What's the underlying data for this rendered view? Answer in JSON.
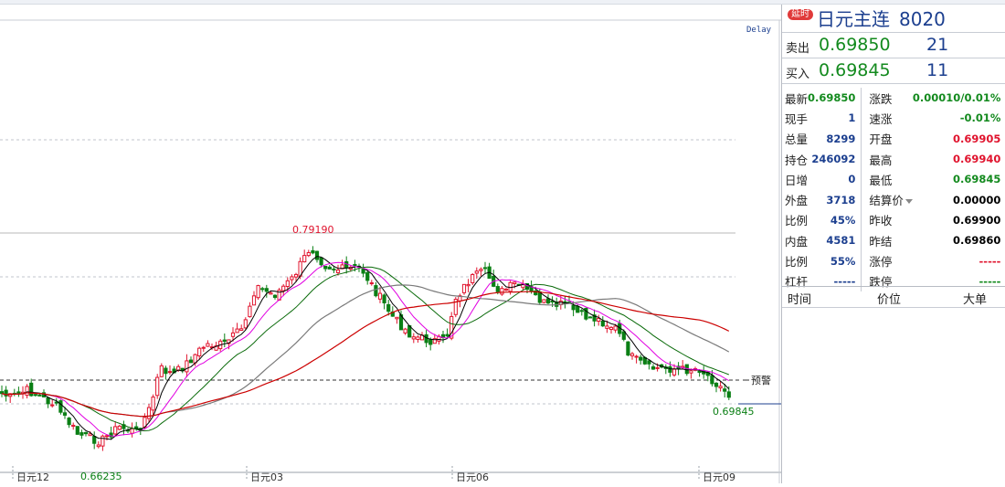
{
  "chart_data": {
    "type": "candlestick",
    "x_labels": [
      "日元12",
      "日元03",
      "日元06",
      "日元09"
    ],
    "annotations": {
      "high": "0.79190",
      "low": "0.66235",
      "last": "0.69845",
      "alert": "预警"
    },
    "corner_label": "Delay",
    "ylim": [
      0.645,
      0.865
    ],
    "colors": {
      "up": "#e0142e",
      "down": "#0a7f14",
      "ma5": "#000000",
      "ma10": "#e100e1",
      "ma20": "#0b6b0b",
      "ma40": "#7a7a7a",
      "ma60": "#cc0000"
    }
  },
  "quote": {
    "delay_badge": "延时",
    "name": "日元主连",
    "code": "8020",
    "sell_label": "卖出",
    "sell_price": "0.69850",
    "sell_qty": "21",
    "buy_label": "买入",
    "buy_price": "0.69845",
    "buy_qty": "11",
    "stats": [
      {
        "k": "最新",
        "v": "0.69850",
        "k2": "涨跌",
        "v2": "0.00010/0.01%"
      },
      {
        "k": "现手",
        "v": "1",
        "k2": "速涨",
        "v2": "-0.01%"
      },
      {
        "k": "总量",
        "v": "8299",
        "k2": "开盘",
        "v2": "0.69905"
      },
      {
        "k": "持仓",
        "v": "246092",
        "k2": "最高",
        "v2": "0.69940"
      },
      {
        "k": "日增",
        "v": "0",
        "k2": "最低",
        "v2": "0.69845"
      },
      {
        "k": "外盘",
        "v": "3718",
        "k2": "结算价",
        "v2": "0.00000"
      },
      {
        "k": "比例",
        "v": "45%",
        "k2": "昨收",
        "v2": "0.69900"
      },
      {
        "k": "内盘",
        "v": "4581",
        "k2": "昨结",
        "v2": "0.69860"
      },
      {
        "k": "比例",
        "v": "55%",
        "k2": "涨停",
        "v2": "-----"
      },
      {
        "k": "杠杆",
        "v": "-----",
        "k2": "跌停",
        "v2": "-----"
      }
    ],
    "tick_headers": [
      "时间",
      "价位",
      "大单"
    ]
  }
}
